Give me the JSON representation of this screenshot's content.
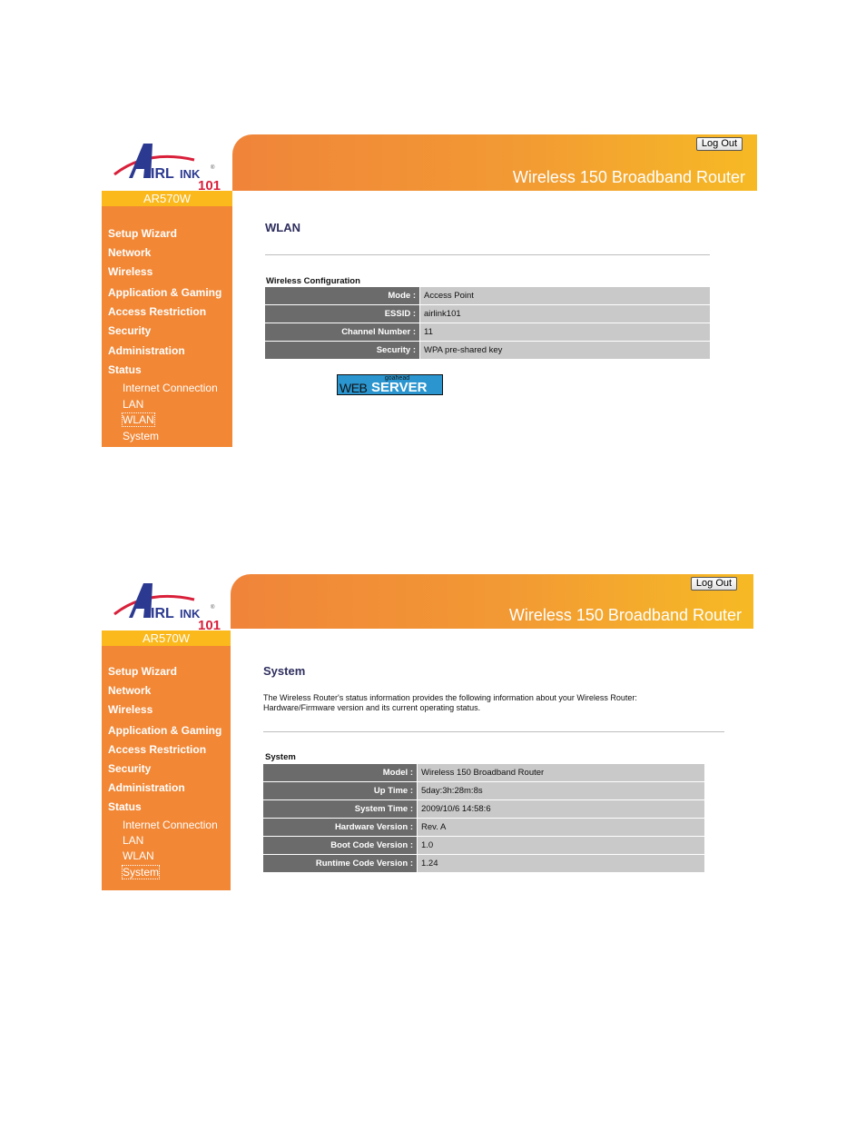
{
  "brand": {
    "logo_text": "AIRLINK",
    "logo_sub": "101",
    "model": "AR570W"
  },
  "header": {
    "title": "Wireless 150 Broadband Router",
    "logout_label": "Log Out"
  },
  "sidebar": {
    "items": [
      {
        "label": "Setup Wizard"
      },
      {
        "label": "Network"
      },
      {
        "label": "Wireless"
      },
      {
        "label": "Application & Gaming"
      },
      {
        "label": "Access Restriction"
      },
      {
        "label": "Security"
      },
      {
        "label": "Administration"
      },
      {
        "label": "Status"
      }
    ],
    "status_subitems": [
      {
        "label": "Internet Connection"
      },
      {
        "label": "LAN"
      },
      {
        "label": "WLAN"
      },
      {
        "label": "System"
      }
    ]
  },
  "panels": {
    "wlan": {
      "page_title": "WLAN",
      "active_subitem": "WLAN",
      "section_label": "Wireless Configuration",
      "rows": [
        {
          "key": "Mode :",
          "value": "Access Point"
        },
        {
          "key": "ESSID :",
          "value": "airlink101"
        },
        {
          "key": "Channel Number :",
          "value": "11"
        },
        {
          "key": "Security :",
          "value": "WPA pre-shared key"
        }
      ],
      "badge": {
        "small": "goahead",
        "left": "WEB",
        "right": "SERVER",
        "color": "#2a95cf"
      }
    },
    "system": {
      "page_title": "System",
      "active_subitem": "System",
      "description_line1": "The Wireless Router's status information provides the following information about your Wireless Router:",
      "description_line2": "Hardware/Firmware version and its current operating status.",
      "section_label": "System",
      "rows": [
        {
          "key": "Model :",
          "value": "Wireless 150 Broadband Router"
        },
        {
          "key": "Up Time :",
          "value": "5day:3h:28m:8s"
        },
        {
          "key": "System Time :",
          "value": "2009/10/6 14:58:6"
        },
        {
          "key": "Hardware Version :",
          "value": "Rev. A"
        },
        {
          "key": "Boot Code Version :",
          "value": "1.0"
        },
        {
          "key": "Runtime Code Version :",
          "value": "1.24"
        }
      ]
    }
  },
  "colors": {
    "sidebar_orange": "#f28735",
    "model_bar_yellow": "#fbb91c",
    "key_cell_gray": "#6b6b6b",
    "value_cell_gray": "#c9c9c9",
    "title_navy": "#2e2e5e"
  }
}
